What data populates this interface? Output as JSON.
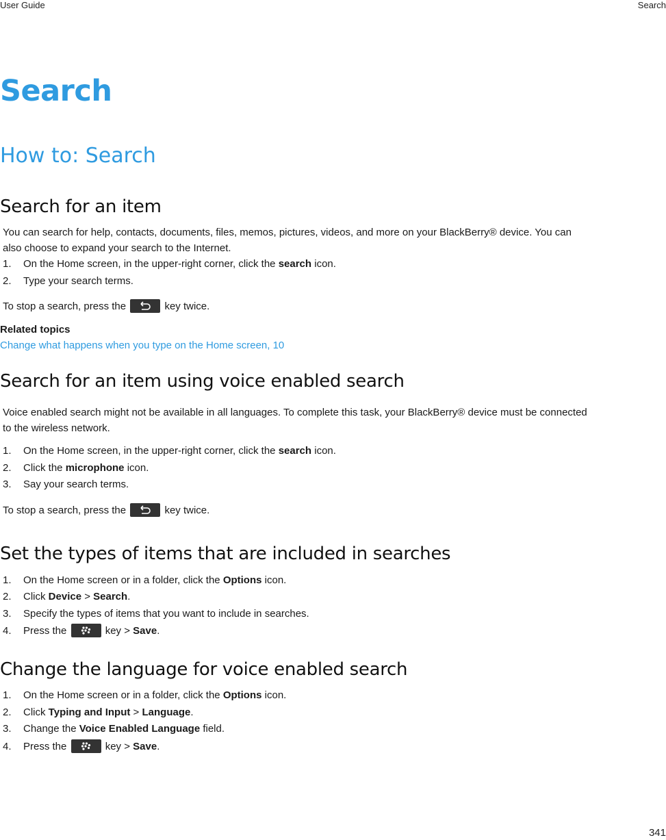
{
  "header": {
    "left": "User Guide",
    "right": "Search"
  },
  "title": "Search",
  "subtitle": "How to: Search",
  "sections": {
    "item": {
      "heading": "Search for an item",
      "intro_1": "You can search for help, contacts, documents, files, memos, pictures, videos, and more on your BlackBerry® device. You can",
      "intro_2": "also choose to expand your search to the Internet.",
      "steps": [
        {
          "num": "1.",
          "pre": "On the Home screen, in the upper-right corner, click the ",
          "bold": "search",
          "post": " icon."
        },
        {
          "num": "2.",
          "text": "Type your search terms."
        }
      ],
      "stop_pre": "To stop a search, press the",
      "stop_post": "key twice.",
      "related_title": "Related topics",
      "related_link": "Change what happens when you type on the Home screen, 10"
    },
    "voice": {
      "heading": "Search for an item using voice enabled search",
      "intro_1": "Voice enabled search might not be available in all languages. To complete this task, your BlackBerry® device must be connected",
      "intro_2": "to the wireless network.",
      "steps": [
        {
          "num": "1.",
          "pre": "On the Home screen, in the upper-right corner, click the ",
          "bold": "search",
          "post": " icon."
        },
        {
          "num": "2.",
          "pre": "Click the ",
          "bold": "microphone",
          "post": " icon."
        },
        {
          "num": "3.",
          "text": "Say your search terms."
        }
      ],
      "stop_pre": "To stop a search, press the",
      "stop_post": "key twice."
    },
    "types": {
      "heading": "Set the types of items that are included in searches",
      "steps": [
        {
          "num": "1.",
          "pre": "On the Home screen or in a folder, click the ",
          "bold": "Options",
          "post": " icon."
        },
        {
          "num": "2.",
          "pre": "Click ",
          "bold": "Device",
          "mid": " > ",
          "bold2": "Search",
          "post": "."
        },
        {
          "num": "3.",
          "text": "Specify the types of items that you want to include in searches."
        },
        {
          "num": "4.",
          "pre": "Press the",
          "mid": "key > ",
          "bold": "Save",
          "post": "."
        }
      ]
    },
    "language": {
      "heading": "Change the language for voice enabled search",
      "steps": [
        {
          "num": "1.",
          "pre": "On the Home screen or in a folder, click the ",
          "bold": "Options",
          "post": " icon."
        },
        {
          "num": "2.",
          "pre": "Click ",
          "bold": "Typing and Input",
          "mid": " > ",
          "bold2": "Language",
          "post": "."
        },
        {
          "num": "3.",
          "pre": "Change the ",
          "bold": "Voice Enabled Language",
          "post": " field."
        },
        {
          "num": "4.",
          "pre": "Press the",
          "mid": "key > ",
          "bold": "Save",
          "post": "."
        }
      ]
    }
  },
  "icons": {
    "back_key": "back-key-icon",
    "menu_key": "blackberry-menu-key-icon"
  },
  "colors": {
    "accent": "#2f9be0",
    "key_bg": "#333333"
  },
  "page_number": "341"
}
